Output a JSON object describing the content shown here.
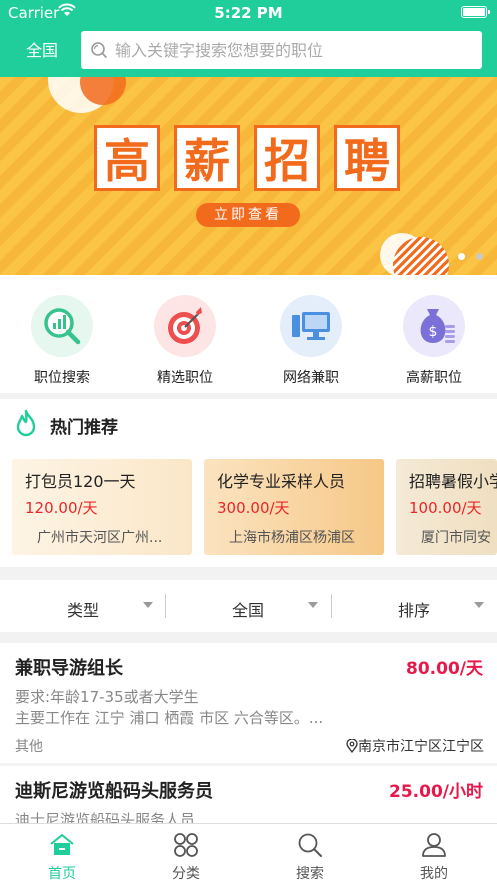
{
  "status": {
    "carrier": "Carrier",
    "time": "5:22 PM"
  },
  "header": {
    "region": "全国",
    "search_placeholder": "输入关键字搜索您想要的职位"
  },
  "banner": {
    "chars": [
      "高",
      "薪",
      "招",
      "聘"
    ],
    "cta": "立即查看",
    "active_dot": 0,
    "dots": 2
  },
  "categories": [
    {
      "label": "职位搜索",
      "icon": "job-search-icon"
    },
    {
      "label": "精选职位",
      "icon": "target-icon"
    },
    {
      "label": "网络兼职",
      "icon": "computer-icon"
    },
    {
      "label": "高薪职位",
      "icon": "money-bag-icon"
    }
  ],
  "hot": {
    "title": "热门推荐",
    "cards": [
      {
        "title": "打包员120一天",
        "price": "120.00/天",
        "location": "广州市天河区广州..."
      },
      {
        "title": "化学专业采样人员",
        "price": "300.00/天",
        "location": "上海市杨浦区杨浦区"
      },
      {
        "title": "招聘暑假小学",
        "price": "100.00/天",
        "location": "厦门市同安"
      }
    ]
  },
  "filters": [
    {
      "label": "类型"
    },
    {
      "label": "全国"
    },
    {
      "label": "排序"
    }
  ],
  "jobs": [
    {
      "title": "兼职导游组长",
      "salary": "80.00/天",
      "desc1": "要求:年龄17-35或者大学生",
      "desc2": "主要工作在 江宁 浦口 栖霞 市区 六合等区。...",
      "category": "其他",
      "location": "南京市江宁区江宁区"
    },
    {
      "title": "迪斯尼游览船码头服务员",
      "salary": "25.00/小时",
      "desc1": "迪士尼游览船码头服务人员"
    }
  ],
  "tabs": [
    {
      "label": "首页",
      "icon": "home-icon",
      "active": true
    },
    {
      "label": "分类",
      "icon": "category-grid-icon",
      "active": false
    },
    {
      "label": "搜索",
      "icon": "search-icon",
      "active": false
    },
    {
      "label": "我的",
      "icon": "profile-icon",
      "active": false
    }
  ],
  "colors": {
    "accent": "#1fce9a",
    "price": "#e8272b",
    "salary": "#e8194a",
    "banner_orange": "#f26a1c"
  }
}
